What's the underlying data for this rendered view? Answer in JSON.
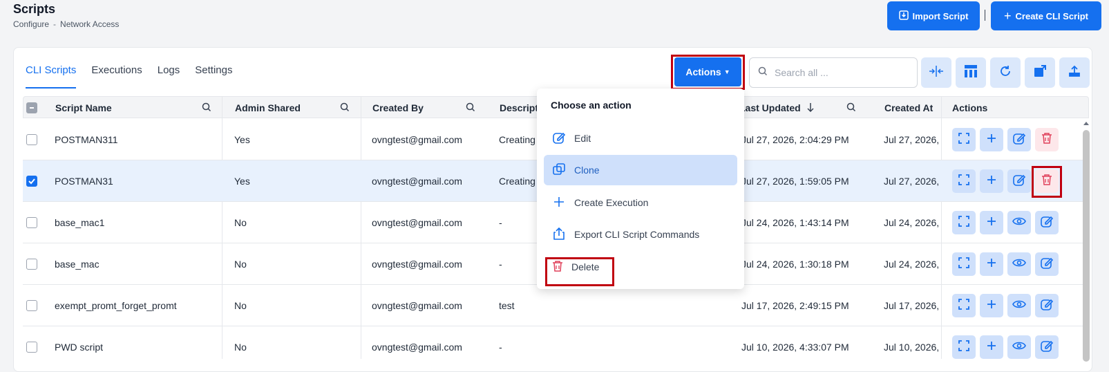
{
  "header": {
    "title": "Scripts",
    "breadcrumb": [
      "Configure",
      "Network Access"
    ],
    "breadcrumb_sep": "-",
    "import_label": "Import Script",
    "create_label": "Create CLI Script"
  },
  "tabs": [
    "CLI Scripts",
    "Executions",
    "Logs",
    "Settings"
  ],
  "toolbar": {
    "actions_label": "Actions",
    "search_placeholder": "Search all ..."
  },
  "columns": [
    "Script Name",
    "Admin Shared",
    "Created By",
    "Descripti",
    "Last Updated",
    "Created At",
    "Actions"
  ],
  "rows": [
    {
      "name": "POSTMAN311",
      "shared": "Yes",
      "created_by": "ovngtest@gmail.com",
      "desc": "Creating",
      "updated": "Jul 27, 2026, 2:04:29 PM",
      "created": "Jul 27, 2026, 2",
      "selected": false
    },
    {
      "name": "POSTMAN31",
      "shared": "Yes",
      "created_by": "ovngtest@gmail.com",
      "desc": "Creating",
      "updated": "Jul 27, 2026, 1:59:05 PM",
      "created": "Jul 27, 2026,",
      "selected": true
    },
    {
      "name": "base_mac1",
      "shared": "No",
      "created_by": "ovngtest@gmail.com",
      "desc": "-",
      "updated": "Jul 24, 2026, 1:43:14 PM",
      "created": "Jul 24, 2026,",
      "selected": false
    },
    {
      "name": "base_mac",
      "shared": "No",
      "created_by": "ovngtest@gmail.com",
      "desc": "-",
      "updated": "Jul 24, 2026, 1:30:18 PM",
      "created": "Jul 24, 2026,",
      "selected": false
    },
    {
      "name": "exempt_promt_forget_promt",
      "shared": "No",
      "created_by": "ovngtest@gmail.com",
      "desc": "test",
      "updated": "Jul 17, 2026, 2:49:15 PM",
      "created": "Jul 17, 2026,",
      "selected": false
    },
    {
      "name": "PWD script",
      "shared": "No",
      "created_by": "ovngtest@gmail.com",
      "desc": "-",
      "updated": "Jul 10, 2026, 4:33:07 PM",
      "created": "Jul 10, 2026, 4",
      "selected": false
    }
  ],
  "dropdown": {
    "title": "Choose an action",
    "items": [
      "Edit",
      "Clone",
      "Create Execution",
      "Export CLI Script Commands",
      "Delete"
    ]
  },
  "colors": {
    "primary": "#1570ef",
    "highlight": "#c00010",
    "danger": "#e0405a"
  }
}
